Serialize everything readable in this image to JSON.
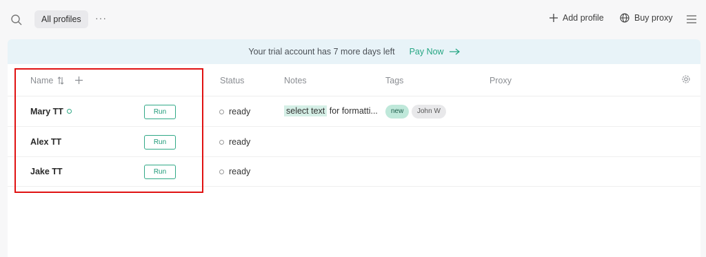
{
  "toolbar": {
    "filter_label": "All profiles",
    "more_label": "···",
    "add_profile_label": "Add profile",
    "buy_proxy_label": "Buy proxy"
  },
  "banner": {
    "message": "Your trial account has 7 more days left",
    "pay_label": "Pay Now"
  },
  "columns": {
    "name": "Name",
    "status": "Status",
    "notes": "Notes",
    "tags": "Tags",
    "proxy": "Proxy"
  },
  "rows": [
    {
      "name": "Mary TT",
      "run": "Run",
      "status": "ready",
      "note_highlight": "select text",
      "note_rest": " for formatti...",
      "tags": [
        "new",
        "John W"
      ]
    },
    {
      "name": "Alex TT",
      "run": "Run",
      "status": "ready"
    },
    {
      "name": "Jake TT",
      "run": "Run",
      "status": "ready"
    }
  ],
  "colors": {
    "accent": "#2fa886",
    "banner_bg": "#e8f3f8",
    "highlight_border": "#e01010"
  }
}
